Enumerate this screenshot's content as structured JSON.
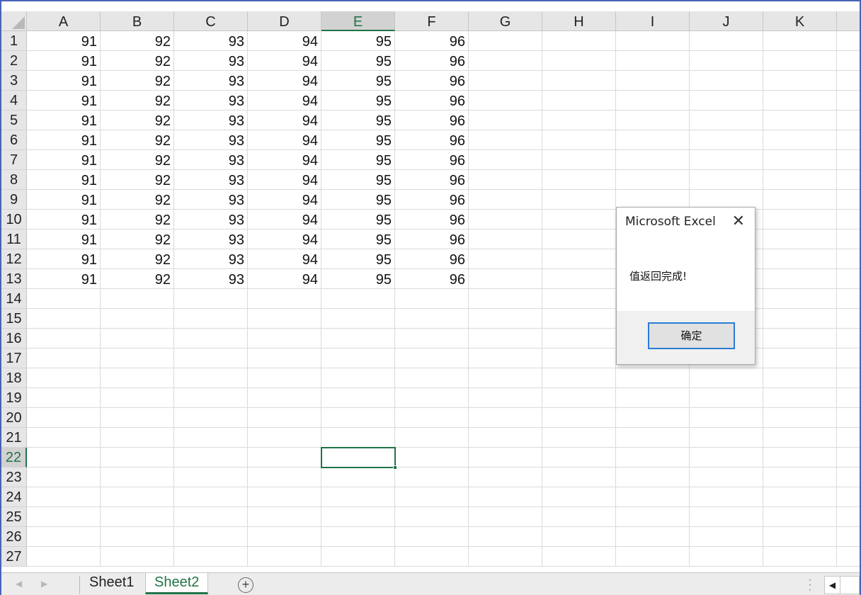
{
  "columns": [
    "A",
    "B",
    "C",
    "D",
    "E",
    "F",
    "G",
    "H",
    "I",
    "J",
    "K"
  ],
  "rows": [
    [
      "91",
      "92",
      "93",
      "94",
      "95",
      "96"
    ],
    [
      "91",
      "92",
      "93",
      "94",
      "95",
      "96"
    ],
    [
      "91",
      "92",
      "93",
      "94",
      "95",
      "96"
    ],
    [
      "91",
      "92",
      "93",
      "94",
      "95",
      "96"
    ],
    [
      "91",
      "92",
      "93",
      "94",
      "95",
      "96"
    ],
    [
      "91",
      "92",
      "93",
      "94",
      "95",
      "96"
    ],
    [
      "91",
      "92",
      "93",
      "94",
      "95",
      "96"
    ],
    [
      "91",
      "92",
      "93",
      "94",
      "95",
      "96"
    ],
    [
      "91",
      "92",
      "93",
      "94",
      "95",
      "96"
    ],
    [
      "91",
      "92",
      "93",
      "94",
      "95",
      "96"
    ],
    [
      "91",
      "92",
      "93",
      "94",
      "95",
      "96"
    ],
    [
      "91",
      "92",
      "93",
      "94",
      "95",
      "96"
    ],
    [
      "91",
      "92",
      "93",
      "94",
      "95",
      "96"
    ]
  ],
  "row_count": 27,
  "selected_cell": {
    "column": "E",
    "row": "22"
  },
  "sheet_tabs": [
    {
      "label": "Sheet1",
      "active": false
    },
    {
      "label": "Sheet2",
      "active": true
    }
  ],
  "dialog": {
    "title": "Microsoft Excel",
    "message": "值返回完成!",
    "ok_label": "确定"
  },
  "icons": {
    "close": "close-icon",
    "add_sheet": "plus-circle-icon",
    "scroll_left": "triangle-left-icon"
  },
  "colors": {
    "accent": "#217346",
    "dialog_button_border": "#2a7bd6",
    "header_bg": "#e6e6e6",
    "frame": "#4a63b7"
  }
}
